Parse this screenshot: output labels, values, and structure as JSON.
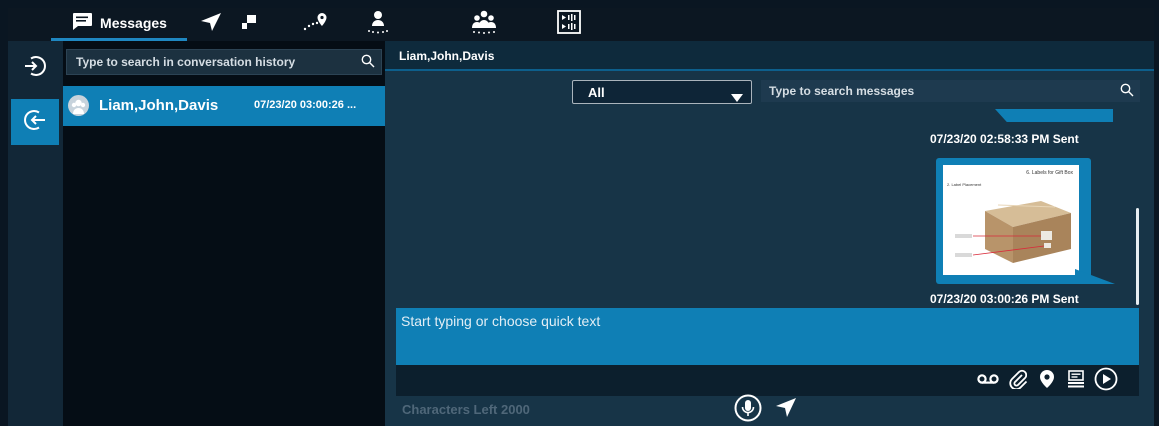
{
  "tabs": {
    "messages_label": "Messages"
  },
  "conversations": {
    "search_placeholder": "Type to search in conversation history",
    "items": [
      {
        "name": "Liam,John,Davis",
        "time": "07/23/20 03:00:26 ..."
      }
    ]
  },
  "chat": {
    "title": "Liam,John,Davis",
    "filter_value": "All",
    "search_placeholder": "Type to search messages",
    "messages": [
      {
        "stamp": "07/23/20 02:58:33 PM Sent"
      },
      {
        "stamp": "07/23/20 03:00:26 PM Sent",
        "image_caption": "6. Labels for Gift Box",
        "image_sublabel": "2. Label Placement"
      }
    ],
    "compose_placeholder": "Start typing or choose quick text",
    "chars_left": "Characters Left 2000"
  },
  "colors": {
    "accent": "#0f7fb5",
    "panel": "#173447",
    "background": "#0a1622"
  }
}
